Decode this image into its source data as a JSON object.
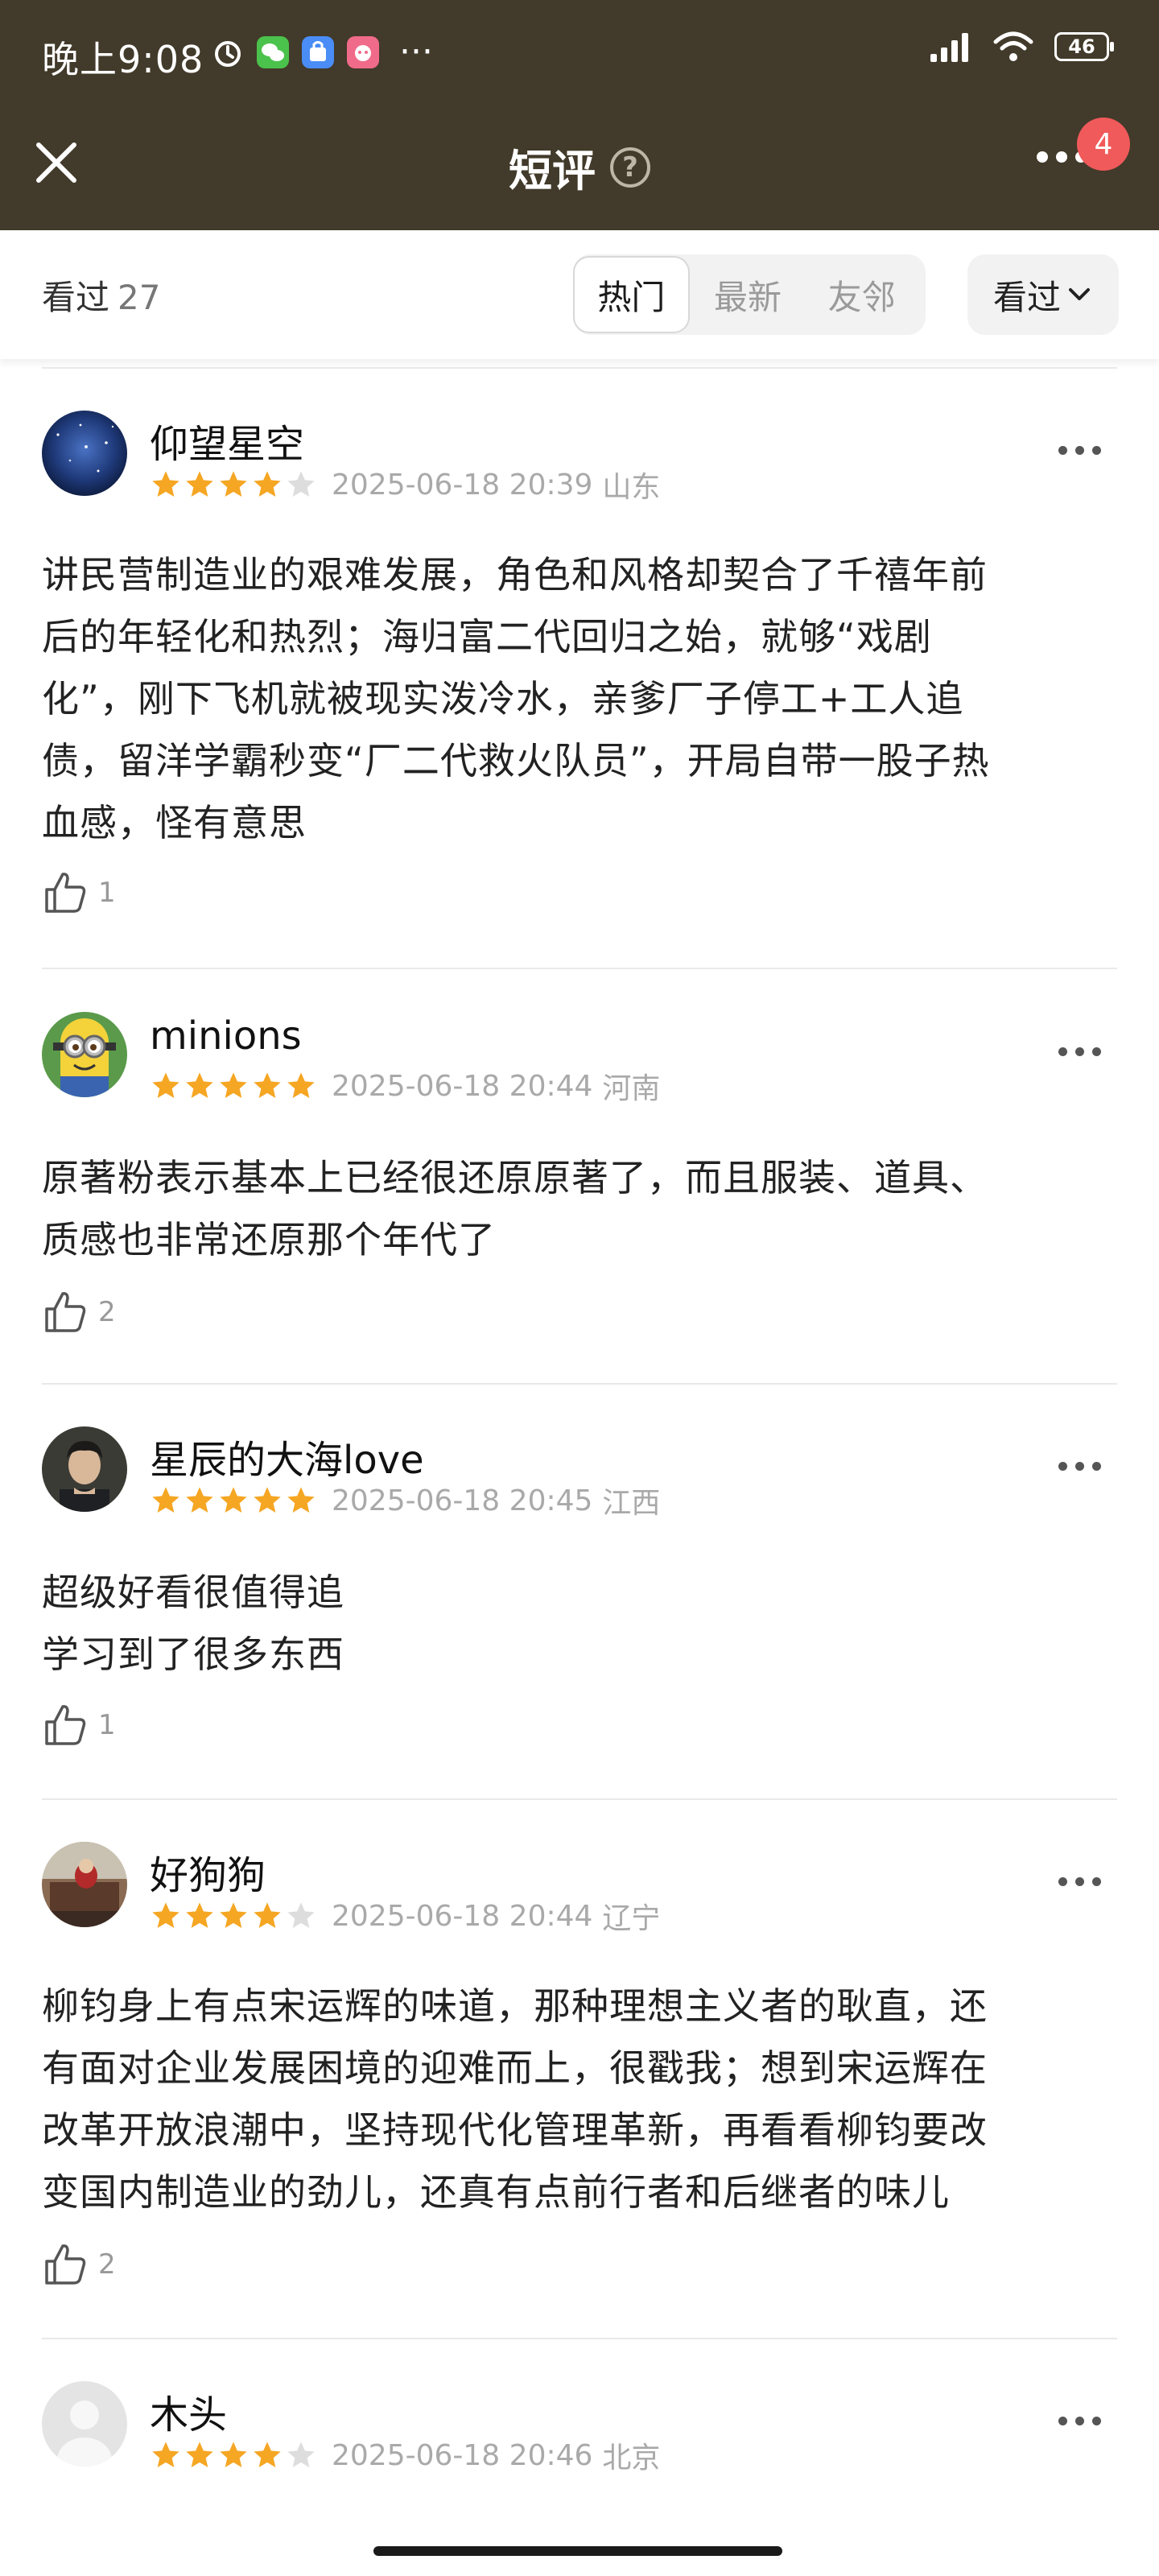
{
  "status_bar": {
    "time": "晚上9:08",
    "battery": "46",
    "more_dots": "···"
  },
  "header": {
    "title": "短评",
    "help": "?",
    "badge_count": "4"
  },
  "filter": {
    "seen_label": "看过",
    "seen_count": "27",
    "tabs": [
      {
        "label": "热门",
        "active": true
      },
      {
        "label": "最新",
        "active": false
      },
      {
        "label": "友邻",
        "active": false
      }
    ],
    "dropdown_label": "看过"
  },
  "colors": {
    "header_bg": "#423a2a",
    "star_filled": "#f5a623",
    "star_empty": "#dddddd",
    "badge": "#f05a5a"
  },
  "reviews": [
    {
      "username": "仰望星空",
      "rating": 4,
      "datetime": "2025-06-18 20:39",
      "location": "山东",
      "text": "讲民营制造业的艰难发展，角色和风格却契合了千禧年前\n后的年轻化和热烈；海归富二代回归之始，就够“戏剧\n化”，刚下飞机就被现实泼冷水，亲爹厂子停工+工人追\n债，留洋学霸秒变“厂二代救火队员”，开局自带一股子热\n血感，怪有意思",
      "likes": "1"
    },
    {
      "username": "minions",
      "rating": 5,
      "datetime": "2025-06-18 20:44",
      "location": "河南",
      "text": "原著粉表示基本上已经很还原原著了，而且服装、道具、\n质感也非常还原那个年代了",
      "likes": "2"
    },
    {
      "username": "星辰的大海love",
      "rating": 5,
      "datetime": "2025-06-18 20:45",
      "location": "江西",
      "text": "超级好看很值得追\n学习到了很多东西",
      "likes": "1"
    },
    {
      "username": "好狗狗",
      "rating": 4,
      "datetime": "2025-06-18 20:44",
      "location": "辽宁",
      "text": "柳钧身上有点宋运辉的味道，那种理想主义者的耿直，还\n有面对企业发展困境的迎难而上，很戳我；想到宋运辉在\n改革开放浪潮中，坚持现代化管理革新，再看看柳钧要改\n变国内制造业的劲儿，还真有点前行者和后继者的味儿",
      "likes": "2"
    },
    {
      "username": "木头",
      "rating": 4,
      "datetime": "2025-06-18 20:46",
      "location": "北京",
      "text": "",
      "likes": ""
    }
  ]
}
